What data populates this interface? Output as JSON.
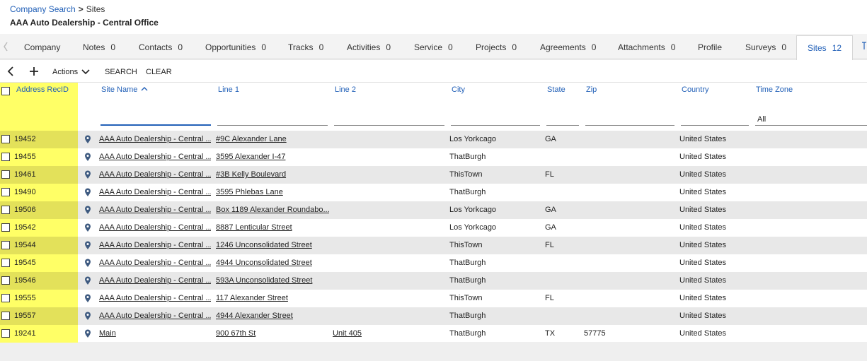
{
  "breadcrumb": {
    "parent": "Company Search",
    "current": "Sites"
  },
  "page_title": "AAA Auto Dealership - Central Office",
  "tabs": [
    {
      "label": "Company",
      "count": ""
    },
    {
      "label": "Notes",
      "count": "0"
    },
    {
      "label": "Contacts",
      "count": "0"
    },
    {
      "label": "Opportunities",
      "count": "0"
    },
    {
      "label": "Tracks",
      "count": "0"
    },
    {
      "label": "Activities",
      "count": "0"
    },
    {
      "label": "Service",
      "count": "0"
    },
    {
      "label": "Projects",
      "count": "0"
    },
    {
      "label": "Agreements",
      "count": "0"
    },
    {
      "label": "Attachments",
      "count": "0"
    },
    {
      "label": "Profile",
      "count": ""
    },
    {
      "label": "Surveys",
      "count": "0"
    },
    {
      "label": "Sites",
      "count": "12"
    }
  ],
  "toolbar": {
    "actions_label": "Actions",
    "search_label": "SEARCH",
    "clear_label": "CLEAR"
  },
  "columns": [
    "Address RecID",
    "Site Name",
    "Line 1",
    "Line 2",
    "City",
    "State",
    "Zip",
    "Country",
    "Time Zone"
  ],
  "filters": {
    "time_zone": "All"
  },
  "rows": [
    {
      "id": "19452",
      "site": "AAA Auto Dealership - Central ...",
      "line1": "#9C Alexander Lane",
      "line2": "",
      "city": "Los Yorkcago",
      "state": "GA",
      "zip": "",
      "country": "United States",
      "tz": ""
    },
    {
      "id": "19455",
      "site": "AAA Auto Dealership - Central ...",
      "line1": "3595 Alexander I-47",
      "line2": "",
      "city": "ThatBurgh",
      "state": "",
      "zip": "",
      "country": "United States",
      "tz": ""
    },
    {
      "id": "19461",
      "site": "AAA Auto Dealership - Central ...",
      "line1": "#3B Kelly Boulevard",
      "line2": "",
      "city": "ThisTown",
      "state": "FL",
      "zip": "",
      "country": "United States",
      "tz": ""
    },
    {
      "id": "19490",
      "site": "AAA Auto Dealership - Central ...",
      "line1": "3595 Phlebas Lane",
      "line2": "",
      "city": "ThatBurgh",
      "state": "",
      "zip": "",
      "country": "United States",
      "tz": ""
    },
    {
      "id": "19506",
      "site": "AAA Auto Dealership - Central ...",
      "line1": "Box 1189 Alexander Roundabo...",
      "line2": "",
      "city": "Los Yorkcago",
      "state": "GA",
      "zip": "",
      "country": "United States",
      "tz": ""
    },
    {
      "id": "19542",
      "site": "AAA Auto Dealership - Central ...",
      "line1": "8887 Lenticular Street",
      "line2": "",
      "city": "Los Yorkcago",
      "state": "GA",
      "zip": "",
      "country": "United States",
      "tz": ""
    },
    {
      "id": "19544",
      "site": "AAA Auto Dealership - Central ...",
      "line1": "1246 Unconsolidated Street",
      "line2": "",
      "city": "ThisTown",
      "state": "FL",
      "zip": "",
      "country": "United States",
      "tz": ""
    },
    {
      "id": "19545",
      "site": "AAA Auto Dealership - Central ...",
      "line1": "4944 Unconsolidated Street",
      "line2": "",
      "city": "ThatBurgh",
      "state": "",
      "zip": "",
      "country": "United States",
      "tz": ""
    },
    {
      "id": "19546",
      "site": "AAA Auto Dealership - Central ...",
      "line1": "593A Unconsolidated Street",
      "line2": "",
      "city": "ThatBurgh",
      "state": "",
      "zip": "",
      "country": "United States",
      "tz": ""
    },
    {
      "id": "19555",
      "site": "AAA Auto Dealership - Central ...",
      "line1": "117 Alexander Street",
      "line2": "",
      "city": "ThisTown",
      "state": "FL",
      "zip": "",
      "country": "United States",
      "tz": ""
    },
    {
      "id": "19557",
      "site": "AAA Auto Dealership - Central ...",
      "line1": "4944 Alexander Street",
      "line2": "",
      "city": "ThatBurgh",
      "state": "",
      "zip": "",
      "country": "United States",
      "tz": ""
    },
    {
      "id": "19241",
      "site": "Main",
      "line1": "900 67th St",
      "line2": "Unit 405",
      "city": "ThatBurgh",
      "state": "TX",
      "zip": "57775",
      "country": "United States",
      "tz": ""
    }
  ],
  "colors": {
    "link": "#2361b8",
    "highlight_column": "#ffff66",
    "highlight_column_alt": "#e3e15a",
    "row_alt": "#e8e8e8"
  }
}
